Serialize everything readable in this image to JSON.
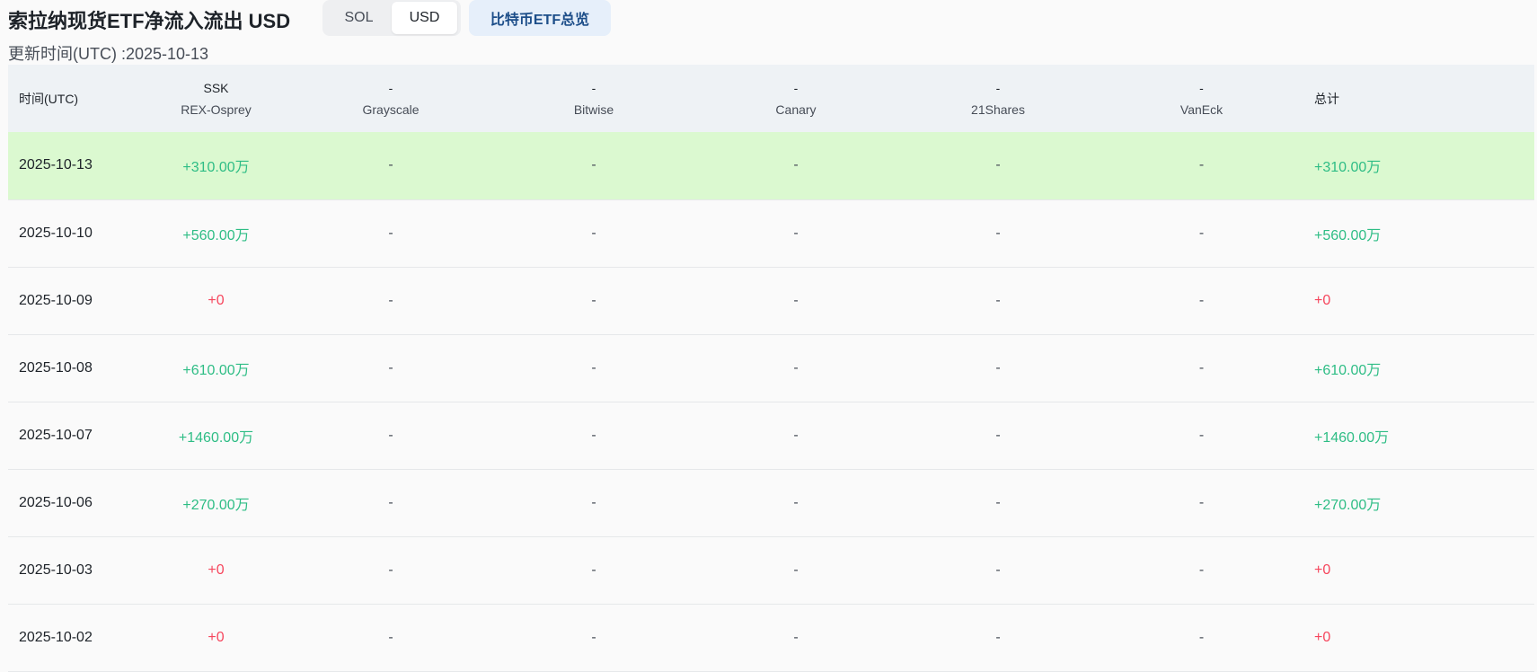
{
  "header": {
    "title": "索拉纳现货ETF净流入流出 USD",
    "unit_options": [
      "SOL",
      "USD"
    ],
    "unit_selected": "USD",
    "overview_button": "比特币ETF总览",
    "update_time": "更新时间(UTC) :2025-10-13"
  },
  "table": {
    "time_header": "时间(UTC)",
    "total_header": "总计",
    "columns": [
      {
        "ticker": "SSK",
        "issuer": "REX-Osprey"
      },
      {
        "ticker": "-",
        "issuer": "Grayscale"
      },
      {
        "ticker": "-",
        "issuer": "Bitwise"
      },
      {
        "ticker": "-",
        "issuer": "Canary"
      },
      {
        "ticker": "-",
        "issuer": "21Shares"
      },
      {
        "ticker": "-",
        "issuer": "VanEck"
      }
    ],
    "rows": [
      {
        "date": "2025-10-13",
        "values": [
          "+310.00万",
          "-",
          "-",
          "-",
          "-",
          "-"
        ],
        "total": "+310.00万"
      },
      {
        "date": "2025-10-10",
        "values": [
          "+560.00万",
          "-",
          "-",
          "-",
          "-",
          "-"
        ],
        "total": "+560.00万"
      },
      {
        "date": "2025-10-09",
        "values": [
          "+0",
          "-",
          "-",
          "-",
          "-",
          "-"
        ],
        "total": "+0"
      },
      {
        "date": "2025-10-08",
        "values": [
          "+610.00万",
          "-",
          "-",
          "-",
          "-",
          "-"
        ],
        "total": "+610.00万"
      },
      {
        "date": "2025-10-07",
        "values": [
          "+1460.00万",
          "-",
          "-",
          "-",
          "-",
          "-"
        ],
        "total": "+1460.00万"
      },
      {
        "date": "2025-10-06",
        "values": [
          "+270.00万",
          "-",
          "-",
          "-",
          "-",
          "-"
        ],
        "total": "+270.00万"
      },
      {
        "date": "2025-10-03",
        "values": [
          "+0",
          "-",
          "-",
          "-",
          "-",
          "-"
        ],
        "total": "+0"
      },
      {
        "date": "2025-10-02",
        "values": [
          "+0",
          "-",
          "-",
          "-",
          "-",
          "-"
        ],
        "total": "+0"
      }
    ]
  },
  "colors": {
    "positive": "#2ebd85",
    "zero": "#f6465d",
    "highlight_row": "#dbf9d0",
    "header_bg": "#eef2f5"
  }
}
